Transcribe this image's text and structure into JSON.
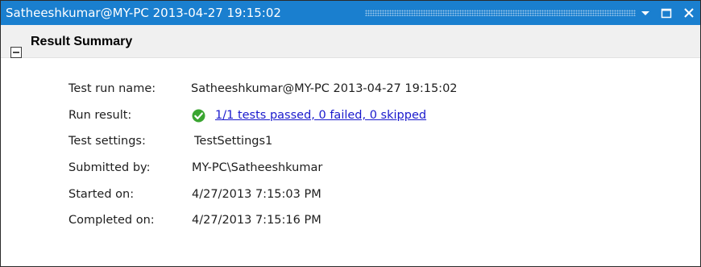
{
  "titlebar": {
    "title": "Satheeshkumar@MY-PC 2013-04-27 19:15:02"
  },
  "section": {
    "title": "Result Summary"
  },
  "details": {
    "test_run_name_label": "Test run name:",
    "test_run_name_value": "Satheeshkumar@MY-PC 2013-04-27 19:15:02",
    "run_result_label": "Run result:",
    "run_result_value": "1/1 tests passed, 0 failed, 0 skipped",
    "test_settings_label": "Test settings:",
    "test_settings_value": "TestSettings1",
    "submitted_by_label": "Submitted by:",
    "submitted_by_value": "MY-PC\\Satheeshkumar",
    "started_on_label": "Started on:",
    "started_on_value": "4/27/2013 7:15:03 PM",
    "completed_on_label": "Completed on:",
    "completed_on_value": "4/27/2013 7:15:16 PM"
  },
  "colors": {
    "titlebar": "#1a7fcf",
    "section_header": "#f0f0f0",
    "link": "#1a1acd",
    "pass_green": "#3aa531"
  },
  "icons": {
    "dropdown": "chevron-down-icon",
    "maximize": "maximize-icon",
    "close": "close-icon",
    "collapse": "collapse-minus-icon",
    "result": "checkmark-icon"
  }
}
